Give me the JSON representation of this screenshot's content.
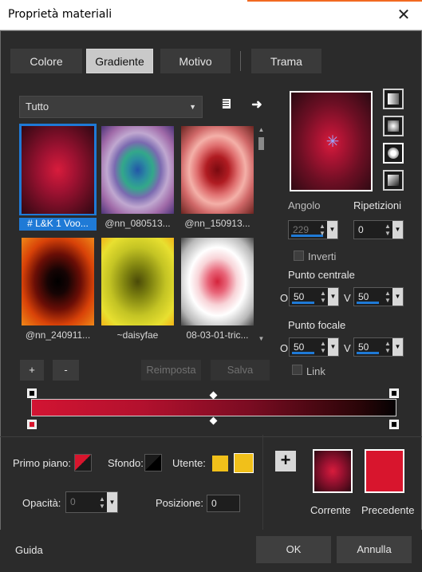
{
  "window": {
    "title": "Proprietà materiali",
    "close_glyph": "✕"
  },
  "tabs": [
    {
      "label": "Colore",
      "active": false
    },
    {
      "label": "Gradiente",
      "active": true
    },
    {
      "label": "Motivo",
      "active": false
    },
    {
      "label": "Trama",
      "active": false
    }
  ],
  "library": {
    "category": "Tutto",
    "items": [
      {
        "caption": "# L&K 1 Voo..."
      },
      {
        "caption": "@nn_080513..."
      },
      {
        "caption": "@nn_150913..."
      },
      {
        "caption": "@nn_240911..."
      },
      {
        "caption": "~daisyfae"
      },
      {
        "caption": "08-03-01-tric..."
      }
    ],
    "add_label": "+",
    "remove_label": "-",
    "reset_label": "Reimposta",
    "save_label": "Salva"
  },
  "settings": {
    "angle_label": "Angolo",
    "angle_value": "229",
    "repeat_label": "Ripetizioni",
    "repeat_value": "0",
    "invert_label": "Inverti",
    "center_label": "Punto centrale",
    "center_o_label": "O",
    "center_o_value": "50",
    "center_v_label": "V",
    "center_v_value": "50",
    "focal_label": "Punto focale",
    "focal_o_label": "O",
    "focal_o_value": "50",
    "focal_v_label": "V",
    "focal_v_value": "50",
    "link_label": "Link"
  },
  "colors": {
    "foreground_label": "Primo piano:",
    "background_label": "Sfondo:",
    "user_label": "Utente:",
    "user_color": "#f1c01a",
    "opacity_label": "Opacità:",
    "opacity_value": "0",
    "position_label": "Posizione:",
    "position_value": "0",
    "current_label": "Corrente",
    "previous_label": "Precedente",
    "previous_color": "#d8152d"
  },
  "footer": {
    "help_label": "Guida",
    "ok_label": "OK",
    "cancel_label": "Annulla"
  }
}
